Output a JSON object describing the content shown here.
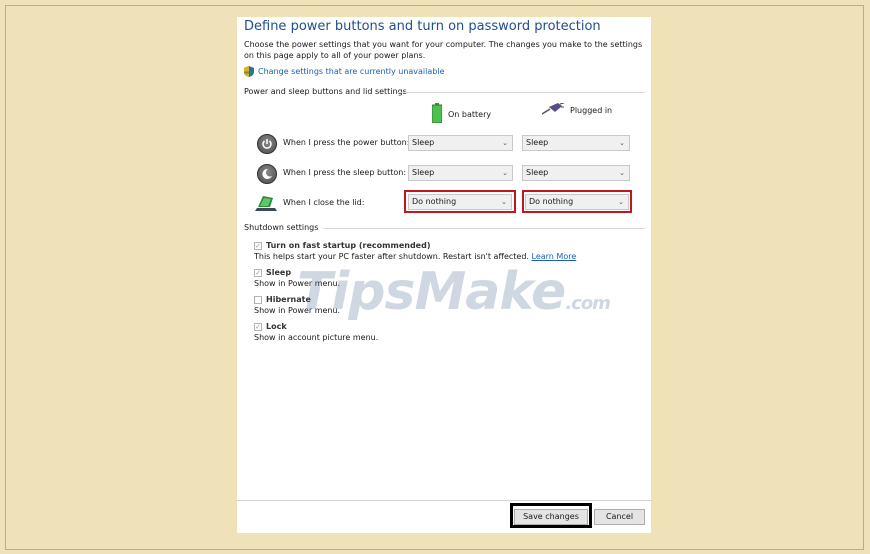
{
  "page": {
    "title": "Define power buttons and turn on password protection",
    "description": "Choose the power settings that you want for your computer. The changes you make to the settings on this page apply to all of your power plans.",
    "change_link": "Change settings that are currently unavailable"
  },
  "power_section": {
    "title": "Power and sleep buttons and lid settings",
    "col_battery": "On battery",
    "col_plugged": "Plugged in",
    "rows": [
      {
        "label": "When I press the power button:",
        "battery": "Sleep",
        "plugged": "Sleep",
        "icon": "power-button-icon"
      },
      {
        "label": "When I press the sleep button:",
        "battery": "Sleep",
        "plugged": "Sleep",
        "icon": "sleep-button-icon"
      },
      {
        "label": "When I close the lid:",
        "battery": "Do nothing",
        "plugged": "Do nothing",
        "icon": "laptop-lid-icon"
      }
    ]
  },
  "shutdown_section": {
    "title": "Shutdown settings",
    "items": [
      {
        "label": "Turn on fast startup (recommended)",
        "sub": "This helps start your PC faster after shutdown. Restart isn't affected.",
        "link": "Learn More",
        "checked": true
      },
      {
        "label": "Sleep",
        "sub": "Show in Power menu.",
        "checked": true
      },
      {
        "label": "Hibernate",
        "sub": "Show in Power menu.",
        "checked": false
      },
      {
        "label": "Lock",
        "sub": "Show in account picture menu.",
        "checked": true
      }
    ]
  },
  "watermark": {
    "main": "TipsMake",
    "suffix": ".com"
  },
  "buttons": {
    "save": "Save changes",
    "cancel": "Cancel"
  },
  "colors": {
    "background": "#efe2b8",
    "highlight_red": "#c0161e",
    "title_blue": "#1e4e8c",
    "link_blue": "#1a5fb4"
  }
}
